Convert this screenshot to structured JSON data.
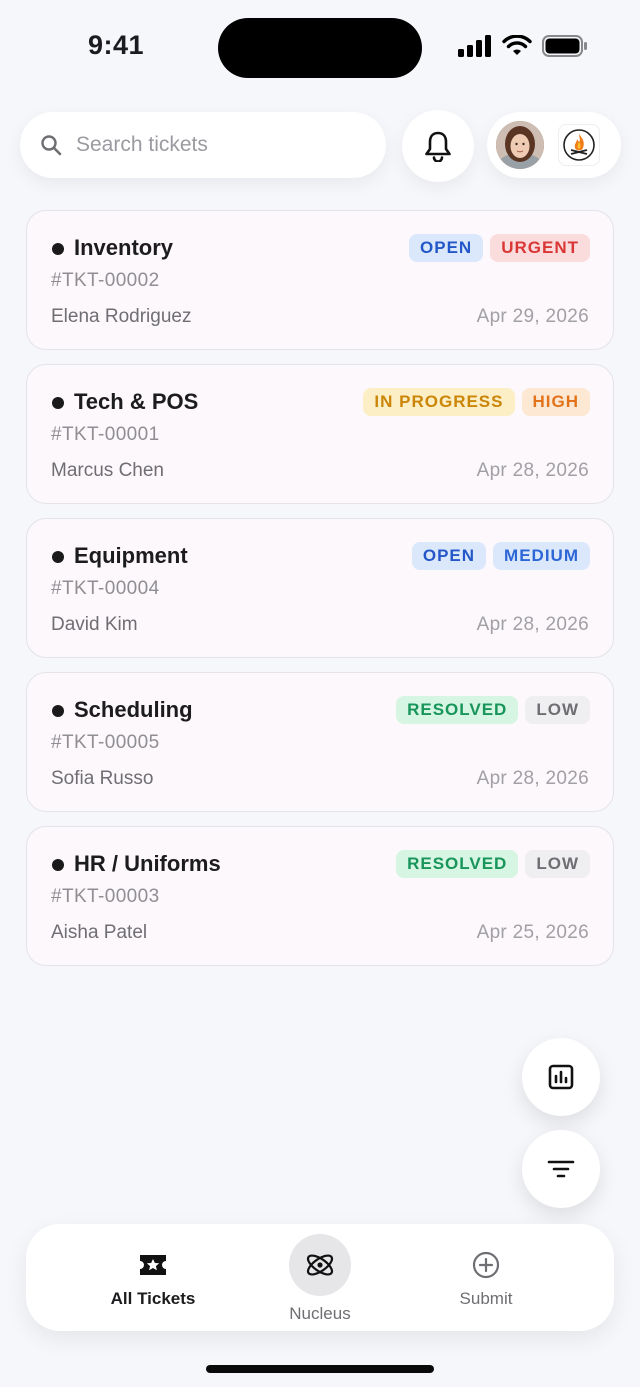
{
  "status_bar": {
    "time": "9:41"
  },
  "search": {
    "placeholder": "Search tickets"
  },
  "tickets": [
    {
      "category": "Inventory",
      "id": "#TKT-00002",
      "assignee": "Elena Rodriguez",
      "date": "Apr 29, 2026",
      "status": "OPEN",
      "priority": "URGENT"
    },
    {
      "category": "Tech & POS",
      "id": "#TKT-00001",
      "assignee": "Marcus Chen",
      "date": "Apr 28, 2026",
      "status": "IN PROGRESS",
      "priority": "HIGH"
    },
    {
      "category": "Equipment",
      "id": "#TKT-00004",
      "assignee": "David Kim",
      "date": "Apr 28, 2026",
      "status": "OPEN",
      "priority": "MEDIUM"
    },
    {
      "category": "Scheduling",
      "id": "#TKT-00005",
      "assignee": "Sofia Russo",
      "date": "Apr 28, 2026",
      "status": "RESOLVED",
      "priority": "LOW"
    },
    {
      "category": "HR / Uniforms",
      "id": "#TKT-00003",
      "assignee": "Aisha Patel",
      "date": "Apr 25, 2026",
      "status": "RESOLVED",
      "priority": "LOW"
    }
  ],
  "bottom_nav": {
    "all_tickets": "All Tickets",
    "nucleus": "Nucleus",
    "submit": "Submit"
  },
  "colors": {
    "open": "#2458c8",
    "urgent": "#d93636",
    "in_progress": "#cb8608",
    "high": "#e2731b",
    "medium": "#2d66d6",
    "resolved": "#17955a",
    "low": "#6e6e73"
  },
  "icons": [
    "search-icon",
    "bell-icon",
    "stats-icon",
    "filter-icon",
    "ticket-star-icon",
    "atom-icon",
    "plus-circle-icon"
  ]
}
